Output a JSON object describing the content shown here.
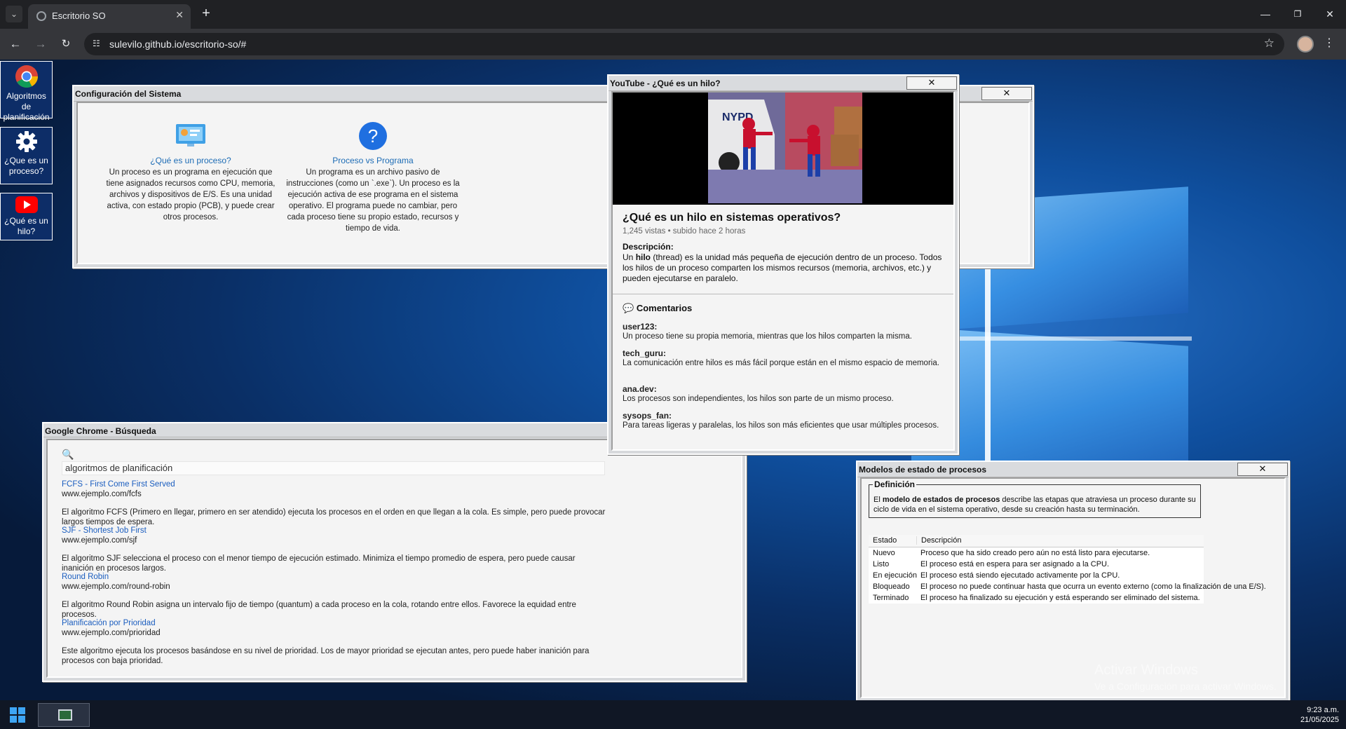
{
  "browser": {
    "tab_title": "Escritorio SO",
    "url": "sulevilo.github.io/escritorio-so/#"
  },
  "desktop_icons": [
    {
      "label": "Algoritmos de planificación"
    },
    {
      "label": "¿Que es un proceso?"
    },
    {
      "label": "¿Qué es un hilo?"
    }
  ],
  "config_window": {
    "title": "Configuración del Sistema",
    "close": "✕",
    "items": [
      {
        "link": "¿Qué es un proceso?",
        "text": "Un proceso es un programa en ejecución que tiene asignados recursos como CPU, memoria, archivos y dispositivos de E/S. Es una unidad activa, con estado propio (PCB), y puede crear otros procesos."
      },
      {
        "link": "Proceso vs Programa",
        "text": "Un programa es un archivo pasivo de instrucciones (como un `.exe`). Un proceso es la ejecución activa de ese programa en el sistema operativo. El programa puede no cambiar, pero cada proceso tiene su propio estado, recursos y tiempo de vida."
      }
    ]
  },
  "youtube_window": {
    "title": "YouTube - ¿Qué es un hilo?",
    "close": "✕",
    "video_title": "¿Qué es un hilo en sistemas operativos?",
    "meta": "1,245 vistas • subido hace 2 horas",
    "desc_label": "Descripción:",
    "desc_pre": "Un ",
    "desc_bold": "hilo",
    "desc_post": " (thread) es la unidad más pequeña de ejecución dentro de un proceso. Todos los hilos de un proceso comparten los mismos recursos (memoria, archivos, etc.) y pueden ejecutarse en paralelo.",
    "thumb_sign": "NYPD",
    "comments_title": "Comentarios",
    "comments": [
      {
        "user": "user123:",
        "text": "Un proceso tiene su propia memoria, mientras que los hilos comparten la misma."
      },
      {
        "user": "tech_guru:",
        "text": "La comunicación entre hilos es más fácil porque están en el mismo espacio de memoria."
      },
      {
        "user": "ana.dev:",
        "text": "Los procesos son independientes, los hilos son parte de un mismo proceso."
      },
      {
        "user": "sysops_fan:",
        "text": "Para tareas ligeras y paralelas, los hilos son más eficientes que usar múltiples procesos."
      }
    ]
  },
  "search_window": {
    "title": "Google Chrome - Búsqueda",
    "query": "algoritmos de planificación",
    "results": [
      {
        "title": "FCFS - First Come First Served",
        "url": "www.ejemplo.com/fcfs",
        "desc": "El algoritmo FCFS (Primero en llegar, primero en ser atendido) ejecuta los procesos en el orden en que llegan a la cola. Es simple, pero puede provocar largos tiempos de espera."
      },
      {
        "title": "SJF - Shortest Job First",
        "url": "www.ejemplo.com/sjf",
        "desc": "El algoritmo SJF selecciona el proceso con el menor tiempo de ejecución estimado. Minimiza el tiempo promedio de espera, pero puede causar inanición en procesos largos."
      },
      {
        "title": "Round Robin",
        "url": "www.ejemplo.com/round-robin",
        "desc": "El algoritmo Round Robin asigna un intervalo fijo de tiempo (quantum) a cada proceso en la cola, rotando entre ellos. Favorece la equidad entre procesos."
      },
      {
        "title": "Planificación por Prioridad",
        "url": "www.ejemplo.com/prioridad",
        "desc": "Este algoritmo ejecuta los procesos basándose en su nivel de prioridad. Los de mayor prioridad se ejecutan antes, pero puede haber inanición para procesos con baja prioridad."
      }
    ]
  },
  "states_window": {
    "title": "Modelos de estado de procesos",
    "close": "✕",
    "legend": "Definición",
    "def_pre": "El ",
    "def_bold": "modelo de estados de procesos",
    "def_post": " describe las etapas que atraviesa un proceso durante su ciclo de vida en el sistema operativo, desde su creación hasta su terminación.",
    "headers": [
      "Estado",
      "Descripción"
    ],
    "rows": [
      [
        "Nuevo",
        "Proceso que ha sido creado pero aún no está listo para ejecutarse."
      ],
      [
        "Listo",
        "El proceso está en espera para ser asignado a la CPU."
      ],
      [
        "En ejecución",
        "El proceso está siendo ejecutado activamente por la CPU."
      ],
      [
        "Bloqueado",
        "El proceso no puede continuar hasta que ocurra un evento externo (como la finalización de una E/S)."
      ],
      [
        "Terminado",
        "El proceso ha finalizado su ejecución y está esperando ser eliminado del sistema."
      ]
    ]
  },
  "watermark": {
    "line1": "Activar Windows",
    "line2": "Ve a Configuración para activar Windows."
  },
  "taskbar": {
    "time": "9:23 a.m.",
    "date": "21/05/2025"
  },
  "colors": {
    "desktop_icon_bg": "#0d2d67",
    "link": "#1d6cb5",
    "tab_bg": "#35363a"
  }
}
